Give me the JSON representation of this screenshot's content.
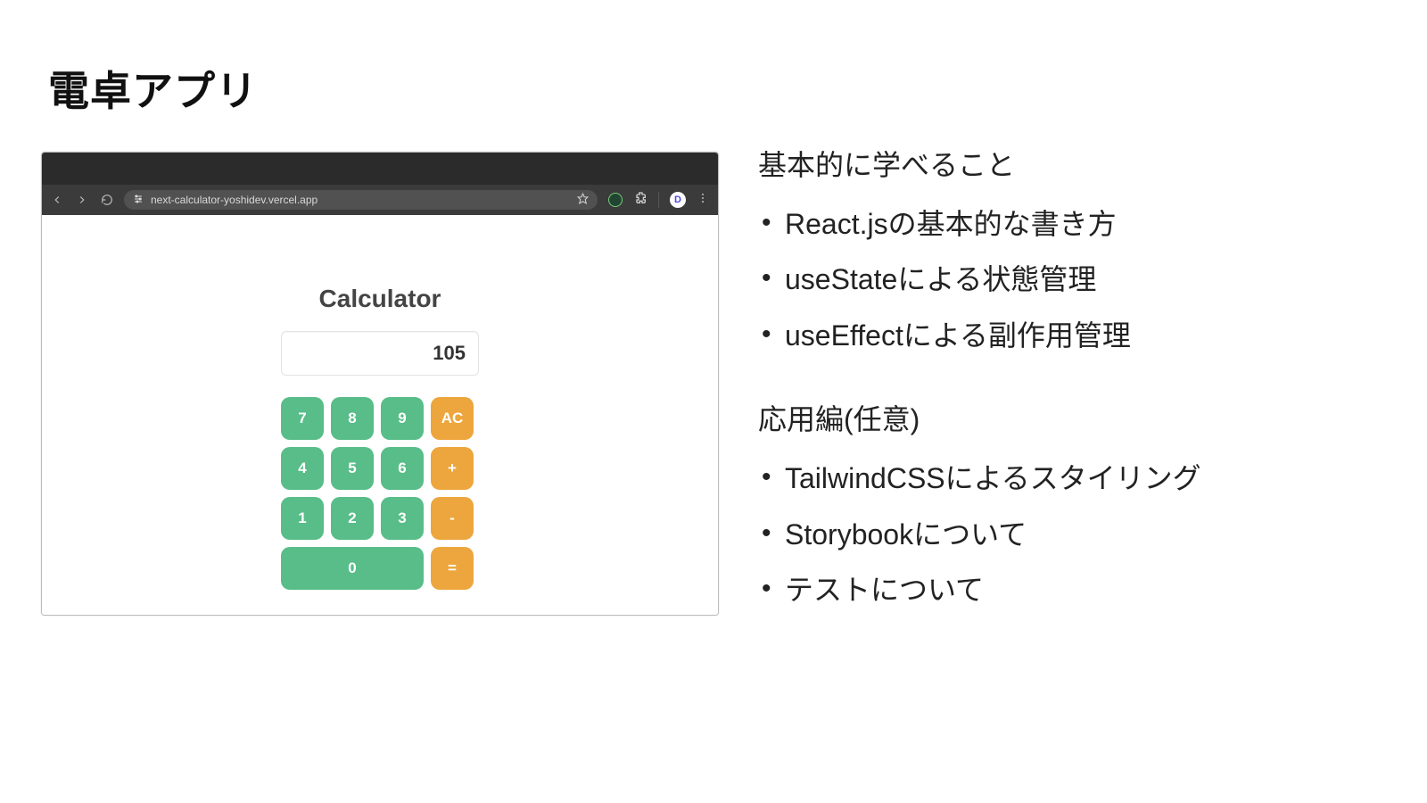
{
  "title": "電卓アプリ",
  "browser": {
    "url": "next-calculator-yoshidev.vercel.app",
    "avatar_initial": "D"
  },
  "calculator": {
    "heading": "Calculator",
    "display": "105",
    "keys": {
      "k7": "7",
      "k8": "8",
      "k9": "9",
      "ac": "AC",
      "k4": "4",
      "k5": "5",
      "k6": "6",
      "plus": "+",
      "k1": "1",
      "k2": "2",
      "k3": "3",
      "minus": "-",
      "k0": "0",
      "eq": "="
    }
  },
  "sections": {
    "basic": {
      "heading": "基本的に学べること",
      "items": [
        "React.jsの基本的な書き方",
        "useStateによる状態管理",
        "useEffectによる副作用管理"
      ]
    },
    "advanced": {
      "heading": "応用編(任意)",
      "items": [
        "TailwindCSSによるスタイリング",
        "Storybookについて",
        "テストについて"
      ]
    }
  }
}
